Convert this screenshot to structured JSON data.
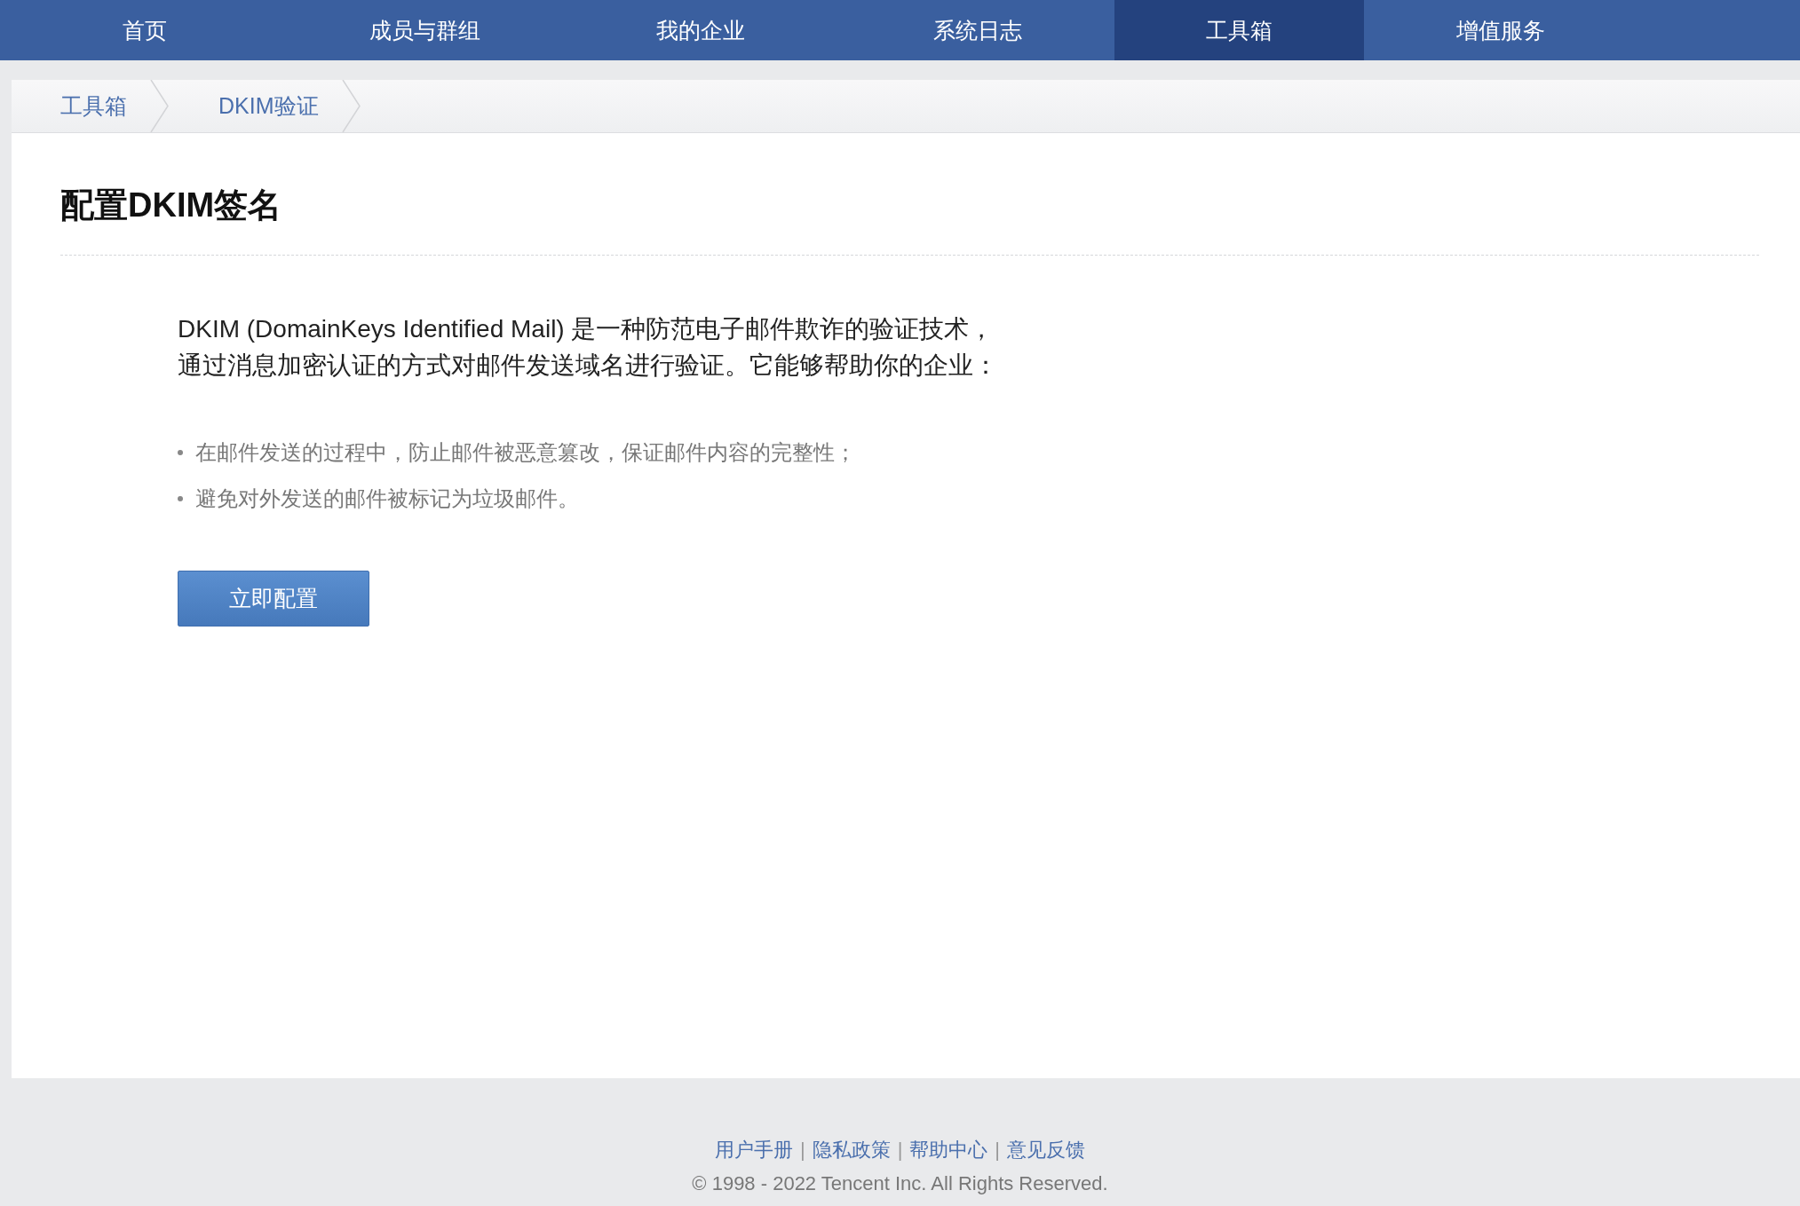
{
  "nav": [
    {
      "label": "首页",
      "selected": false
    },
    {
      "label": "成员与群组",
      "selected": false
    },
    {
      "label": "我的企业",
      "selected": false
    },
    {
      "label": "系统日志",
      "selected": false
    },
    {
      "label": "工具箱",
      "selected": true
    },
    {
      "label": "增值服务",
      "selected": false
    }
  ],
  "breadcrumb": [
    "工具箱",
    "DKIM验证"
  ],
  "title": "配置DKIM签名",
  "intro": [
    "DKIM (DomainKeys Identified Mail) 是一种防范电子邮件欺诈的验证技术，",
    "通过消息加密认证的方式对邮件发送域名进行验证。它能够帮助你的企业："
  ],
  "bullets": [
    "在邮件发送的过程中，防止邮件被恶意篡改，保证邮件内容的完整性；",
    "避免对外发送的邮件被标记为垃圾邮件。"
  ],
  "button": "立即配置",
  "footer": {
    "separator": "|",
    "links": [
      "用户手册",
      "隐私政策",
      "帮助中心",
      "意见反馈"
    ],
    "copyright": "© 1998 - 2022 Tencent Inc. All Rights Reserved."
  }
}
